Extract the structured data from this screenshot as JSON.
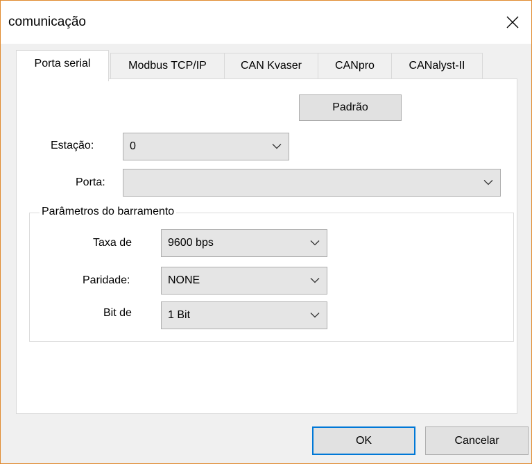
{
  "window": {
    "title": "comunicação"
  },
  "tabs": [
    {
      "label": "Porta serial",
      "active": true
    },
    {
      "label": "Modbus TCP/IP",
      "active": false
    },
    {
      "label": "CAN Kvaser",
      "active": false
    },
    {
      "label": "CANpro",
      "active": false
    },
    {
      "label": "CANalyst-II",
      "active": false
    }
  ],
  "serial": {
    "default_button": "Padrão",
    "station": {
      "label": "Estação:",
      "value": "0"
    },
    "port": {
      "label": "Porta:",
      "value": ""
    },
    "bus_params": {
      "title": "Parâmetros do barramento",
      "baud": {
        "label": "Taxa de",
        "value": "9600 bps"
      },
      "parity": {
        "label": "Paridade:",
        "value": "NONE"
      },
      "stopbits": {
        "label": "Bit de",
        "value": "1 Bit"
      }
    }
  },
  "footer": {
    "ok_label": "OK",
    "cancel_label": "Cancelar"
  },
  "colors": {
    "window_border": "#e08a2e",
    "focus_border": "#0078d7",
    "dialog_bg": "#f0f0f0"
  },
  "icons": {
    "close": "close-icon",
    "dropdown": "chevron-down-icon"
  }
}
